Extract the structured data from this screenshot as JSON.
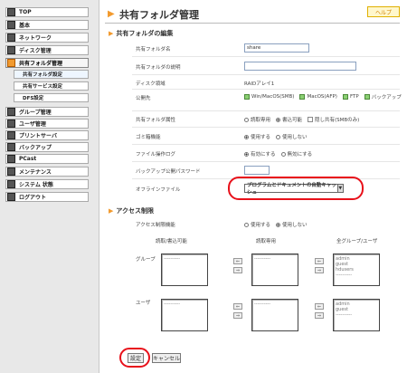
{
  "nav": {
    "items": [
      {
        "label": "TOP"
      },
      {
        "label": "基本"
      },
      {
        "label": "ネットワーク"
      },
      {
        "label": "ディスク管理"
      },
      {
        "label": "共有フォルダ管理"
      },
      {
        "label": "グループ管理"
      },
      {
        "label": "ユーザ管理"
      },
      {
        "label": "プリントサーバ"
      },
      {
        "label": "バックアップ"
      },
      {
        "label": "PCast"
      },
      {
        "label": "メンテナンス"
      },
      {
        "label": "システム 状態"
      },
      {
        "label": "ログアウト"
      }
    ],
    "sub_items": [
      {
        "label": "共有フォルダ設定"
      },
      {
        "label": "共有サービス設定"
      },
      {
        "label": "DFS設定"
      }
    ]
  },
  "page": {
    "title": "共有フォルダ管理",
    "help_label": "ヘルプ"
  },
  "edit_section": {
    "title": "共有フォルダの編集",
    "rows": {
      "name_label": "共有フォルダ名",
      "name_value": "share",
      "desc_label": "共有フォルダの説明",
      "desc_value": "",
      "disk_label": "ディスク領域",
      "disk_value": "RAIDアレイ1",
      "publish_label": "公開先",
      "publish_opts": [
        "Win/MacOS(SMB)",
        "MacOS(AFP)",
        "FTP",
        "バックアップ"
      ],
      "attr_label": "共有フォルダ属性",
      "attr_opts": [
        "読取専用",
        "書込可能",
        "隠し共有(SMBのみ)"
      ],
      "trash_label": "ゴミ箱機能",
      "trash_opts": [
        "使用する",
        "使用しない"
      ],
      "log_label": "ファイル操作ログ",
      "log_opts": [
        "有効にする",
        "無効にする"
      ],
      "backup_pw_label": "バックアップ公開パスワード",
      "backup_pw_value": "",
      "offline_label": "オフラインファイル",
      "offline_value": "プログラムとドキュメントの自動キャッシュ"
    }
  },
  "access_section": {
    "title": "アクセス制限",
    "restrict_label": "アクセス制限機能",
    "restrict_opts": [
      "使用する",
      "使用しない"
    ],
    "col_rw": "読取/書込可能",
    "col_ro": "読取専用",
    "col_all": "全グループ/ユーザ",
    "group_label": "グループ",
    "user_label": "ユーザ",
    "group_list": [
      "admin",
      "guest",
      "hdusers"
    ],
    "user_list": [
      "admin",
      "guest"
    ],
    "list_placeholder": "----------"
  },
  "footer": {
    "save_label": "設定",
    "cancel_label": "キャンセル"
  }
}
